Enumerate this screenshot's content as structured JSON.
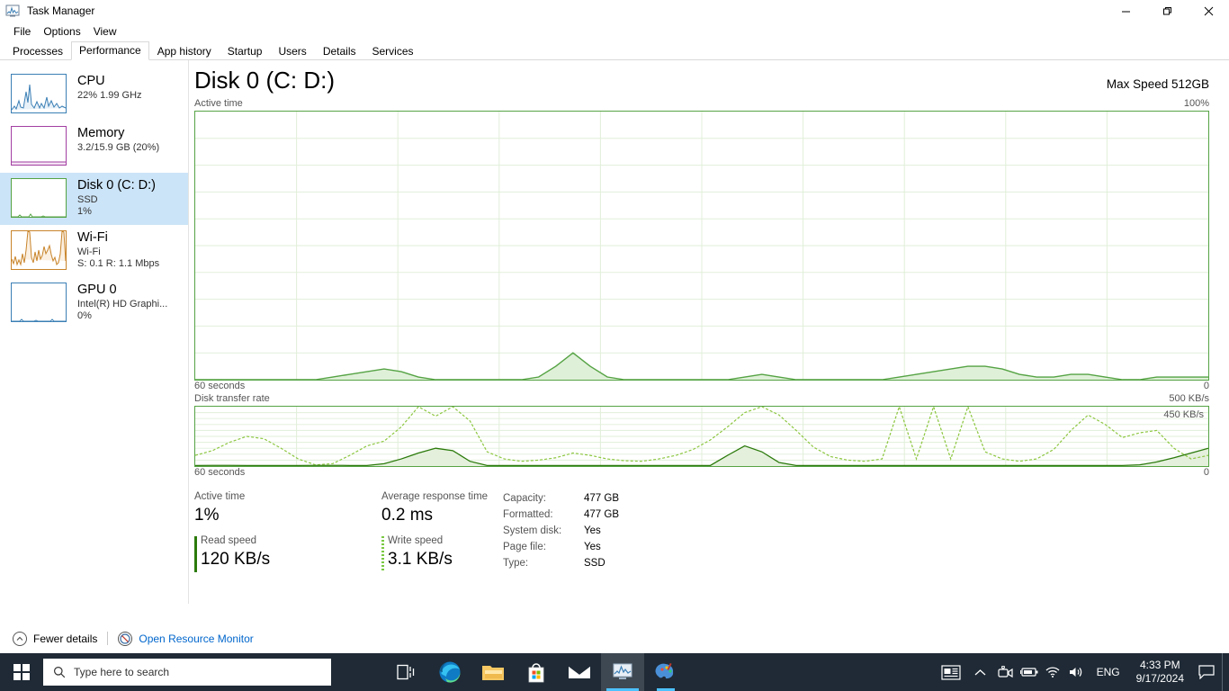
{
  "window": {
    "title": "Task Manager",
    "icon": "task-manager-icon",
    "controls": {
      "minimize": "—",
      "maximize": "❐",
      "close": "✕"
    }
  },
  "menu": {
    "items": [
      "File",
      "Options",
      "View"
    ]
  },
  "tabs": {
    "active": "Performance",
    "items": [
      "Processes",
      "Performance",
      "App history",
      "Startup",
      "Users",
      "Details",
      "Services"
    ]
  },
  "sidebar": {
    "items": [
      {
        "name": "CPU",
        "sub1": "22%  1.99 GHz",
        "sub2": "",
        "selected": false,
        "color": "#3b7fb5"
      },
      {
        "name": "Memory",
        "sub1": "3.2/15.9 GB (20%)",
        "sub2": "",
        "selected": false,
        "color": "#a23fa2"
      },
      {
        "name": "Disk 0 (C: D:)",
        "sub1": "SSD",
        "sub2": "1%",
        "selected": true,
        "color": "#55a344"
      },
      {
        "name": "Wi-Fi",
        "sub1": "Wi-Fi",
        "sub2": "S: 0.1 R: 1.1 Mbps",
        "selected": false,
        "color": "#c8842a"
      },
      {
        "name": "GPU 0",
        "sub1": "Intel(R) HD Graphi...",
        "sub2": "0%",
        "selected": false,
        "color": "#3b7fb5"
      }
    ]
  },
  "main": {
    "heading": "Disk 0 (C: D:)",
    "max_speed": "Max Speed 512GB",
    "graph1": {
      "caption_left": "Active time",
      "caption_right": "100%",
      "footer_left": "60 seconds",
      "footer_right": "0"
    },
    "graph2": {
      "caption_left": "Disk transfer rate",
      "caption_right": "500 KB/s",
      "inline_label": "450 KB/s",
      "footer_left": "60 seconds",
      "footer_right": "0"
    },
    "stats": {
      "active_time_label": "Active time",
      "active_time_value": "1%",
      "avg_response_label": "Average response time",
      "avg_response_value": "0.2 ms",
      "read_speed_label": "Read speed",
      "read_speed_value": "120 KB/s",
      "write_speed_label": "Write speed",
      "write_speed_value": "3.1 KB/s",
      "info": [
        {
          "key": "Capacity:",
          "value": "477 GB"
        },
        {
          "key": "Formatted:",
          "value": "477 GB"
        },
        {
          "key": "System disk:",
          "value": "Yes"
        },
        {
          "key": "Page file:",
          "value": "Yes"
        },
        {
          "key": "Type:",
          "value": "SSD"
        }
      ]
    }
  },
  "status_bar": {
    "fewer_details": "Fewer details",
    "open_resource_monitor": "Open Resource Monitor"
  },
  "taskbar": {
    "start_icon": "windows-logo-icon",
    "search_placeholder": "Type here to search",
    "search_icon": "search-icon",
    "icons": [
      {
        "name": "task-view-icon"
      },
      {
        "name": "microsoft-edge-icon"
      },
      {
        "name": "file-explorer-icon"
      },
      {
        "name": "microsoft-store-icon"
      },
      {
        "name": "mail-icon"
      },
      {
        "name": "task-manager-icon"
      },
      {
        "name": "paint-icon"
      }
    ],
    "tray": {
      "news_icon": "news-and-interests-icon",
      "chevron_icon": "show-hidden-icons-icon",
      "camera_icon": "camera-icon",
      "battery_icon": "battery-icon",
      "wifi_icon": "wifi-icon",
      "volume_icon": "volume-icon",
      "language": "ENG",
      "time": "4:33 PM",
      "date": "9/17/2024",
      "action_center_icon": "action-center-icon"
    }
  },
  "chart_data": [
    {
      "type": "area",
      "title": "Active time",
      "ylabel": "%",
      "ylim": [
        0,
        100
      ],
      "xlabel": "60 seconds",
      "grid": true,
      "line_color": "#55a344",
      "fill_color": "#dff0d8",
      "x": [
        0,
        1,
        2,
        3,
        4,
        5,
        6,
        7,
        8,
        9,
        10,
        11,
        12,
        13,
        14,
        15,
        16,
        17,
        18,
        19,
        20,
        21,
        22,
        23,
        24,
        25,
        26,
        27,
        28,
        29,
        30,
        31,
        32,
        33,
        34,
        35,
        36,
        37,
        38,
        39,
        40,
        41,
        42,
        43,
        44,
        45,
        46,
        47,
        48,
        49,
        50,
        51,
        52,
        53,
        54,
        55,
        56,
        57,
        58,
        59
      ],
      "values": [
        0,
        0,
        0,
        0,
        0,
        0,
        0,
        0,
        1,
        2,
        3,
        4,
        3,
        1,
        0,
        0,
        0,
        0,
        0,
        0,
        1,
        5,
        10,
        5,
        1,
        0,
        0,
        0,
        0,
        0,
        0,
        0,
        1,
        2,
        1,
        0,
        0,
        0,
        0,
        0,
        0,
        1,
        2,
        3,
        4,
        5,
        5,
        4,
        2,
        1,
        1,
        2,
        2,
        1,
        0,
        0,
        1,
        1,
        1,
        1
      ]
    },
    {
      "type": "line",
      "title": "Disk transfer rate",
      "ylabel": "KB/s",
      "ylim": [
        0,
        500
      ],
      "xlabel": "60 seconds",
      "annotation": "450 KB/s",
      "grid": true,
      "series": [
        {
          "name": "Read speed",
          "style": "solid",
          "color": "#2b7a0b",
          "fill": "#e4f0dc",
          "values": [
            5,
            6,
            6,
            5,
            5,
            5,
            5,
            6,
            6,
            5,
            5,
            20,
            60,
            110,
            150,
            130,
            40,
            5,
            5,
            5,
            5,
            5,
            5,
            5,
            5,
            5,
            5,
            5,
            5,
            5,
            5,
            90,
            170,
            120,
            30,
            5,
            5,
            5,
            5,
            5,
            5,
            5,
            5,
            5,
            5,
            5,
            5,
            5,
            5,
            5,
            5,
            5,
            5,
            5,
            5,
            10,
            35,
            70,
            110,
            150
          ]
        },
        {
          "name": "Write speed",
          "style": "dotted",
          "color": "#8cc63f",
          "values": [
            90,
            130,
            200,
            250,
            230,
            150,
            60,
            10,
            20,
            90,
            170,
            210,
            330,
            500,
            420,
            500,
            380,
            120,
            60,
            40,
            50,
            70,
            110,
            90,
            60,
            45,
            40,
            60,
            90,
            140,
            220,
            330,
            450,
            500,
            430,
            300,
            160,
            80,
            50,
            40,
            60,
            500,
            60,
            500,
            60,
            500,
            120,
            60,
            40,
            60,
            140,
            300,
            430,
            350,
            240,
            280,
            300,
            150,
            60,
            90
          ]
        }
      ]
    }
  ]
}
